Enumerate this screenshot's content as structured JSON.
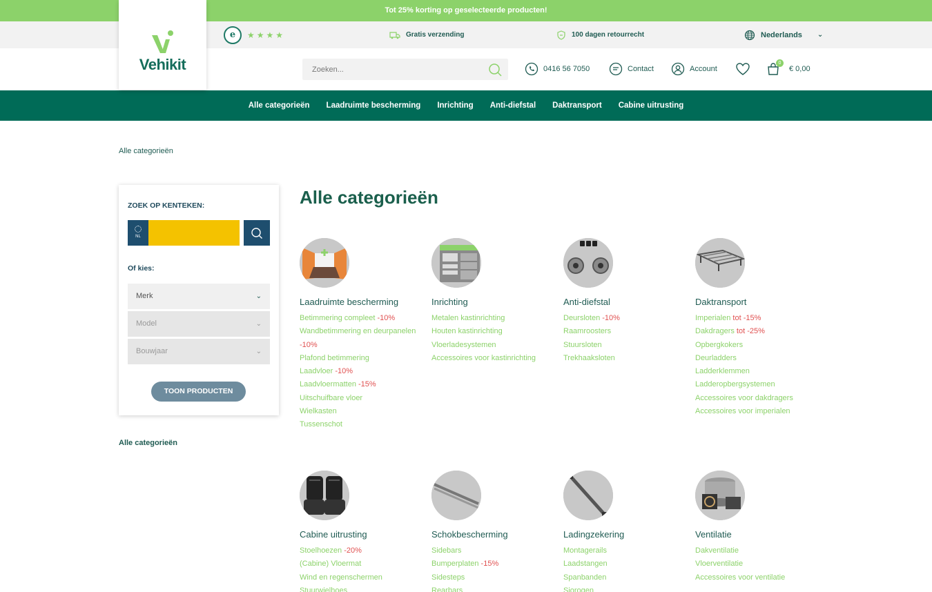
{
  "promo": {
    "text": "Tot 25% korting op geselecteerde producten!"
  },
  "usp": {
    "stars": "★★★★",
    "shipping": "Gratis verzending",
    "returns": "100 dagen retourrecht",
    "language": "Nederlands"
  },
  "logo": {
    "text": "Vehikit"
  },
  "search": {
    "placeholder": "Zoeken..."
  },
  "header": {
    "phone": "0416 56 7050",
    "contact": "Contact",
    "account": "Account",
    "cart_count": "0",
    "cart_total": "€ 0,00"
  },
  "nav": {
    "items": [
      "Alle categorieën",
      "Laadruimte bescherming",
      "Inrichting",
      "Anti-diefstal",
      "Daktransport",
      "Cabine uitrusting"
    ]
  },
  "breadcrumb": "Alle categorieën",
  "filter": {
    "title": "ZOEK OP KENTEKEN:",
    "plate_country": "NL",
    "choose": "Of kies:",
    "selects": [
      "Merk",
      "Model",
      "Bouwjaar"
    ],
    "button": "TOON PRODUCTEN"
  },
  "sidebar_link": "Alle categorieën",
  "page_title": "Alle categorieën",
  "categories": [
    {
      "name": "Laadruimte bescherming",
      "items": [
        {
          "label": "Betimmering compleet",
          "discount": " -10%"
        },
        {
          "label": "Wandbetimmering en deurpanelen",
          "discount": ""
        },
        {
          "label": "",
          "discount": "-10%"
        },
        {
          "label": "Plafond betimmering",
          "discount": ""
        },
        {
          "label": "Laadvloer",
          "discount": " -10%"
        },
        {
          "label": "Laadvloermatten",
          "discount": " -15%"
        },
        {
          "label": "Uitschuifbare vloer",
          "discount": ""
        },
        {
          "label": "Wielkasten",
          "discount": ""
        },
        {
          "label": "Tussenschot",
          "discount": ""
        }
      ]
    },
    {
      "name": "Inrichting",
      "items": [
        {
          "label": "Metalen kastinrichting",
          "discount": ""
        },
        {
          "label": "Houten kastinrichting",
          "discount": ""
        },
        {
          "label": "Vloerladesystemen",
          "discount": ""
        },
        {
          "label": "Accessoires voor kastinrichting",
          "discount": ""
        }
      ]
    },
    {
      "name": "Anti-diefstal",
      "items": [
        {
          "label": "Deursloten",
          "discount": " -10%"
        },
        {
          "label": "Raamroosters",
          "discount": ""
        },
        {
          "label": "Stuursloten",
          "discount": ""
        },
        {
          "label": "Trekhaaksloten",
          "discount": ""
        }
      ]
    },
    {
      "name": "Daktransport",
      "items": [
        {
          "label": "Imperialen",
          "discount": " tot -15%"
        },
        {
          "label": "Dakdragers",
          "discount": " tot -25%"
        },
        {
          "label": "Opbergkokers",
          "discount": ""
        },
        {
          "label": "Deurladders",
          "discount": ""
        },
        {
          "label": "Ladderklemmen",
          "discount": ""
        },
        {
          "label": "Ladderopbergsystemen",
          "discount": ""
        },
        {
          "label": "Accessoires voor dakdragers",
          "discount": ""
        },
        {
          "label": "Accessoires voor imperialen",
          "discount": ""
        }
      ]
    },
    {
      "name": "Cabine uitrusting",
      "items": [
        {
          "label": "Stoelhoezen",
          "discount": " -20%"
        },
        {
          "label": "(Cabine) Vloermat",
          "discount": ""
        },
        {
          "label": "Wind en regenschermen",
          "discount": ""
        },
        {
          "label": "Stuurwielhoes",
          "discount": ""
        }
      ]
    },
    {
      "name": "Schokbescherming",
      "items": [
        {
          "label": "Sidebars",
          "discount": ""
        },
        {
          "label": "Bumperplaten",
          "discount": " -15%"
        },
        {
          "label": "Sidesteps",
          "discount": ""
        },
        {
          "label": "Rearbars",
          "discount": ""
        }
      ]
    },
    {
      "name": "Ladingzekering",
      "items": [
        {
          "label": "Montagerails",
          "discount": ""
        },
        {
          "label": "Laadstangen",
          "discount": ""
        },
        {
          "label": "Spanbanden",
          "discount": ""
        },
        {
          "label": "Sjorogen",
          "discount": ""
        }
      ]
    },
    {
      "name": "Ventilatie",
      "items": [
        {
          "label": "Dakventilatie",
          "discount": ""
        },
        {
          "label": "Vloerventilatie",
          "discount": ""
        },
        {
          "label": "Accessoires voor ventilatie",
          "discount": ""
        }
      ]
    }
  ],
  "colors": {
    "brand_green": "#8cd26a",
    "nav_teal": "#006b57",
    "text_dark": "#1f5b52",
    "plate_yellow": "#f4c200",
    "plate_blue": "#1e4e6e",
    "discount_red": "#e05050"
  }
}
